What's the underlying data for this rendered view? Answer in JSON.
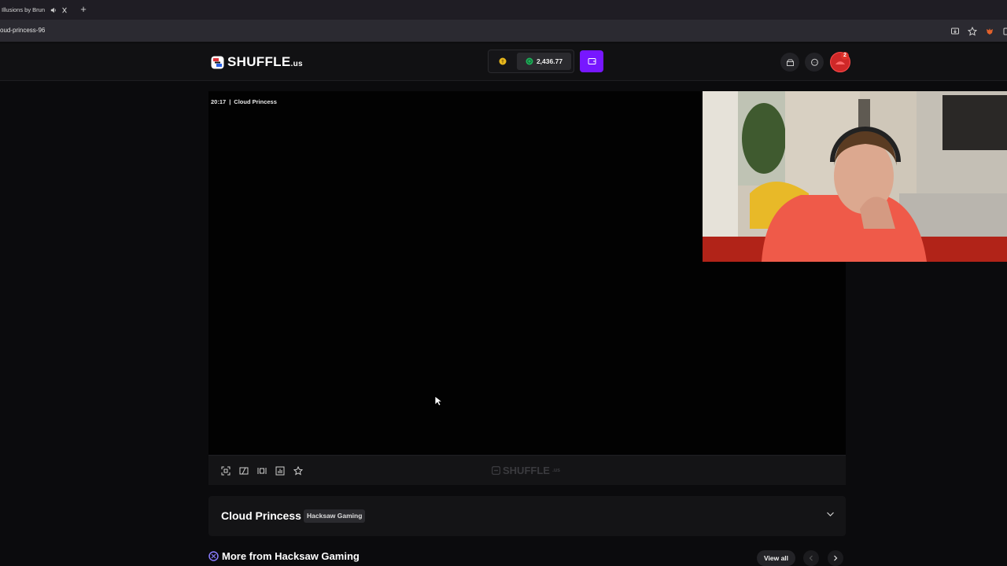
{
  "browser": {
    "tab_title": "Illusions by Brun",
    "url": "oud-princess-96",
    "new_tab": "+"
  },
  "header": {
    "logo_text": "SHUFFLE",
    "logo_suffix": ".us",
    "balance": "2,436.77",
    "notification_count": "2"
  },
  "game": {
    "time": "20:17",
    "separator": "|",
    "name": "Cloud Princess",
    "title": "Cloud Princess",
    "provider": "Hacksaw Gaming",
    "watermark_text": "SHUFFLE",
    "watermark_suffix": ".us"
  },
  "more": {
    "title": "More from Hacksaw Gaming",
    "view_all": "View all"
  },
  "colors": {
    "accent": "#7717ff",
    "background": "#0b0b0d"
  }
}
